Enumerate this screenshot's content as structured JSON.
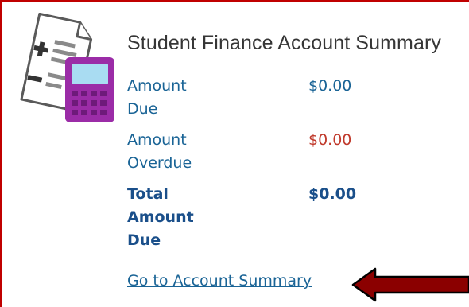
{
  "card": {
    "title": "Student Finance Account Summary",
    "illustration_icon": "calculator-with-document-icon"
  },
  "summary": {
    "amount_due": {
      "label": "Amount\nDue",
      "value": "$0.00"
    },
    "amount_overdue": {
      "label": "Amount\nOverdue",
      "value": "$0.00"
    },
    "total_amount_due": {
      "label": "Total\nAmount\nDue",
      "value": "$0.00"
    }
  },
  "link": {
    "label": "Go to Account Summary"
  },
  "annotation": {
    "icon": "red-arrow-left-icon"
  },
  "colors": {
    "border": "#c00000",
    "link_blue": "#1a6496",
    "total_blue": "#1a4f8a",
    "overdue_red": "#c0392b",
    "arrow_fill": "#8b0000",
    "calculator_purple": "#9b2ca7",
    "calculator_screen": "#a9dcf2"
  }
}
